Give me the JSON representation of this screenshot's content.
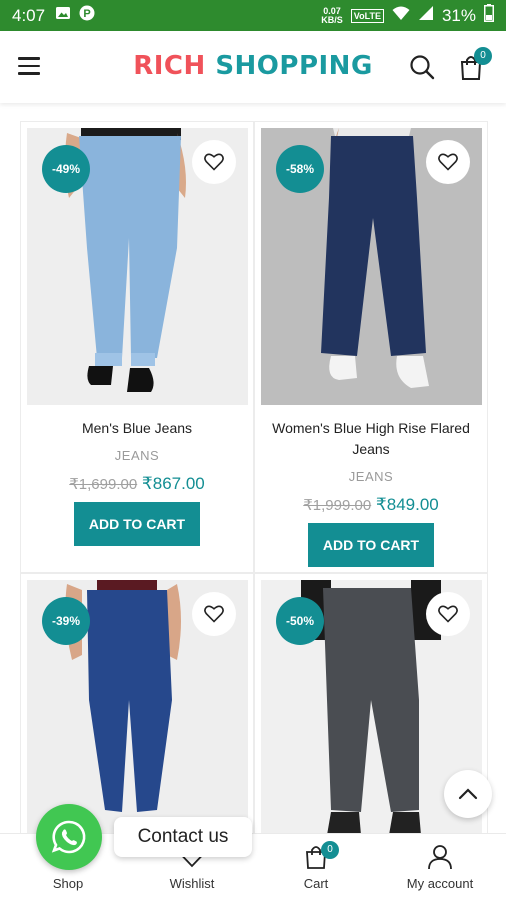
{
  "status": {
    "time": "4:07",
    "speed_value": "0.07",
    "speed_unit": "KB/S",
    "volte": "VoLTE",
    "battery": "31%"
  },
  "header": {
    "logo_part1": "RICH",
    "logo_part2": "SHOPPING",
    "cart_count": "0"
  },
  "products": [
    {
      "discount": "-49%",
      "name": "Men's Blue Jeans",
      "category": "JEANS",
      "old_price": "₹1,699.00",
      "new_price": "₹867.00",
      "button": "ADD TO CART"
    },
    {
      "discount": "-58%",
      "name": "Women's Blue High Rise Flared Jeans",
      "category": "JEANS",
      "old_price": "₹1,999.00",
      "new_price": "₹849.00",
      "button": "ADD TO CART"
    },
    {
      "discount": "-39%"
    },
    {
      "discount": "-50%"
    }
  ],
  "bottom_nav": {
    "shop": "Shop",
    "wishlist": "Wishlist",
    "cart": "Cart",
    "cart_count": "0",
    "account": "My account"
  },
  "contact_label": "Contact us",
  "colors": {
    "accent": "#138e93",
    "logo_red": "#f0525a",
    "logo_teal": "#1a9aa0",
    "status_bar": "#2e8b2e",
    "whatsapp": "#41c752"
  }
}
